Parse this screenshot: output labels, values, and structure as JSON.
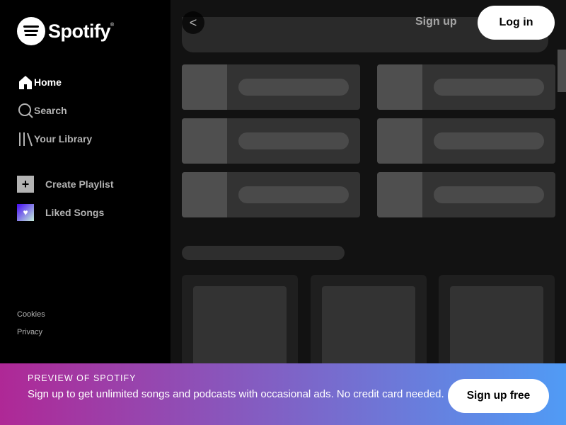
{
  "brand": {
    "name": "Spotify",
    "trademark": "®"
  },
  "nav": {
    "items": [
      {
        "label": "Home",
        "icon": "home-icon",
        "active": true
      },
      {
        "label": "Search",
        "icon": "search-icon",
        "active": false
      },
      {
        "label": "Your Library",
        "icon": "library-icon",
        "active": false
      }
    ]
  },
  "actions": {
    "create_playlist": "Create Playlist",
    "liked_songs": "Liked Songs"
  },
  "footer": {
    "cookies": "Cookies",
    "privacy": "Privacy"
  },
  "header": {
    "back_glyph": "<",
    "signup": "Sign up",
    "login": "Log in"
  },
  "banner": {
    "title": "PREVIEW OF SPOTIFY",
    "text": "Sign up to get unlimited songs and podcasts with occasional ads. No credit card needed.",
    "button": "Sign up free"
  },
  "colors": {
    "background": "#000000",
    "main": "#121212",
    "skeleton": "#333333",
    "banner_start": "#af2896",
    "banner_end": "#509bf5"
  }
}
